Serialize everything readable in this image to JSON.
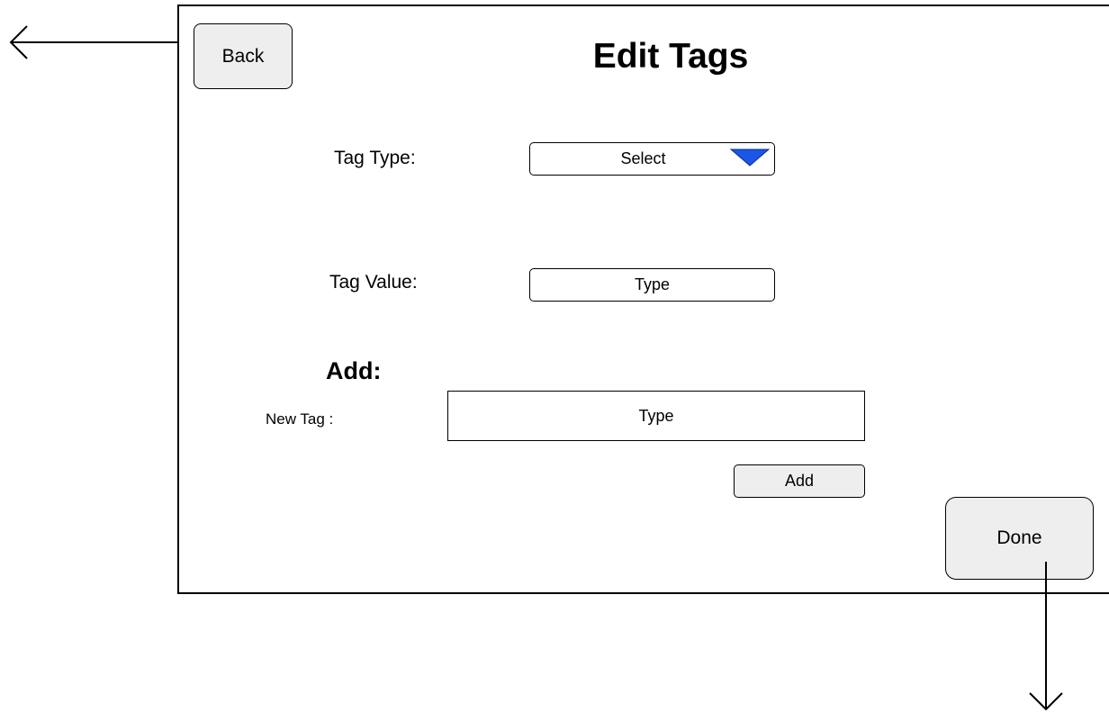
{
  "header": {
    "title": "Edit Tags",
    "back_label": "Back"
  },
  "form": {
    "tag_type": {
      "label": "Tag Type:",
      "selected": "Select"
    },
    "tag_value": {
      "label": "Tag Value:",
      "placeholder": "Type"
    },
    "add_section": {
      "heading": "Add:",
      "new_tag_label": "New Tag :",
      "new_tag_placeholder": "Type",
      "add_label": "Add"
    }
  },
  "footer": {
    "done_label": "Done"
  },
  "colors": {
    "button_fill": "#eeeeee",
    "dropdown_arrow": "#1a56e8",
    "stroke": "#000000"
  },
  "icons": {
    "back_arrow": "arrow-left-icon",
    "done_arrow": "arrow-down-icon",
    "dropdown": "triangle-down-icon"
  }
}
